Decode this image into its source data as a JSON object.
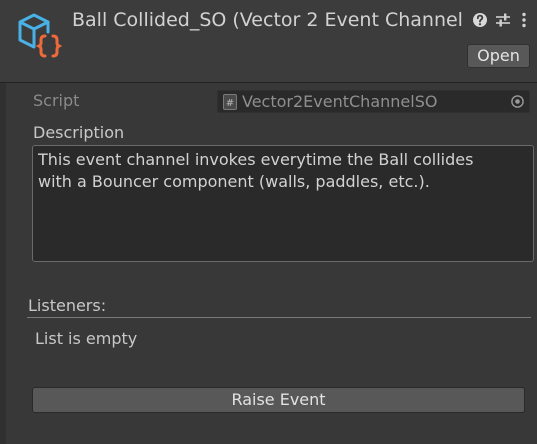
{
  "header": {
    "title": "Ball Collided_SO (Vector 2 Event Channel",
    "icons": [
      "scriptable-object-icon",
      "help-icon",
      "preset-sliders-icon",
      "kebab-menu-icon"
    ],
    "open_label": "Open"
  },
  "inspector": {
    "script": {
      "label": "Script",
      "value": "Vector2EventChannelSO",
      "icon": "csharp-script-icon"
    },
    "description": {
      "label": "Description",
      "text": "This event channel invokes everytime the Ball collides\nwith a Bouncer component (walls, paddles, etc.)."
    },
    "listeners": {
      "label": "Listeners:",
      "empty_text": "List is empty"
    },
    "raise_button": {
      "label": "Raise Event"
    }
  },
  "colors": {
    "background": "#383838",
    "header_background": "#3c3c3c",
    "icon_blue": "#4ab1e6",
    "icon_orange": "#ef6a3a",
    "button": "#585858"
  }
}
